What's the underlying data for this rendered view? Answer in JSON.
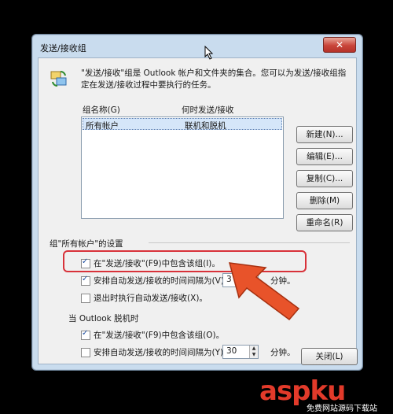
{
  "window": {
    "title": "发送/接收组",
    "close_label": "✕"
  },
  "description": "\"发送/接收\"组是 Outlook 帐户和文件夹的集合。您可以为发送/接收组指定在发送/接收过程中要执行的任务。",
  "list": {
    "col_name": "组名称(G)",
    "col_when": "何时发送/接收",
    "rows": [
      {
        "name": "所有帐户",
        "when": "联机和脱机"
      }
    ]
  },
  "buttons": {
    "new": "新建(N)...",
    "edit": "编辑(E)...",
    "copy": "复制(C)...",
    "delete": "删除(M)",
    "rename": "重命名(R)",
    "close": "关闭(L)"
  },
  "settings": {
    "group_heading": "组\"所有帐户\"的设置",
    "online": {
      "include_label": "在\"发送/接收\"(F9)中包含该组(I)。",
      "include_checked": true,
      "schedule_label": "安排自动发送/接收的时间间隔为(V)",
      "schedule_checked": true,
      "interval": "3",
      "unit": "分钟。",
      "exit_label": "退出时执行自动发送/接收(X)。",
      "exit_checked": false
    },
    "offline_heading": "当 Outlook 脱机时",
    "offline": {
      "include_label": "在\"发送/接收\"(F9)中包含该组(O)。",
      "include_checked": true,
      "schedule_label": "安排自动发送/接收的时间间隔为(Y)",
      "schedule_checked": false,
      "interval": "30",
      "unit": "分钟。"
    }
  },
  "watermark": {
    "brand": "aspku",
    "sub": "免费网站源码下载站"
  },
  "colors": {
    "highlight": "#d8323a",
    "arrow": "#e8532a"
  }
}
